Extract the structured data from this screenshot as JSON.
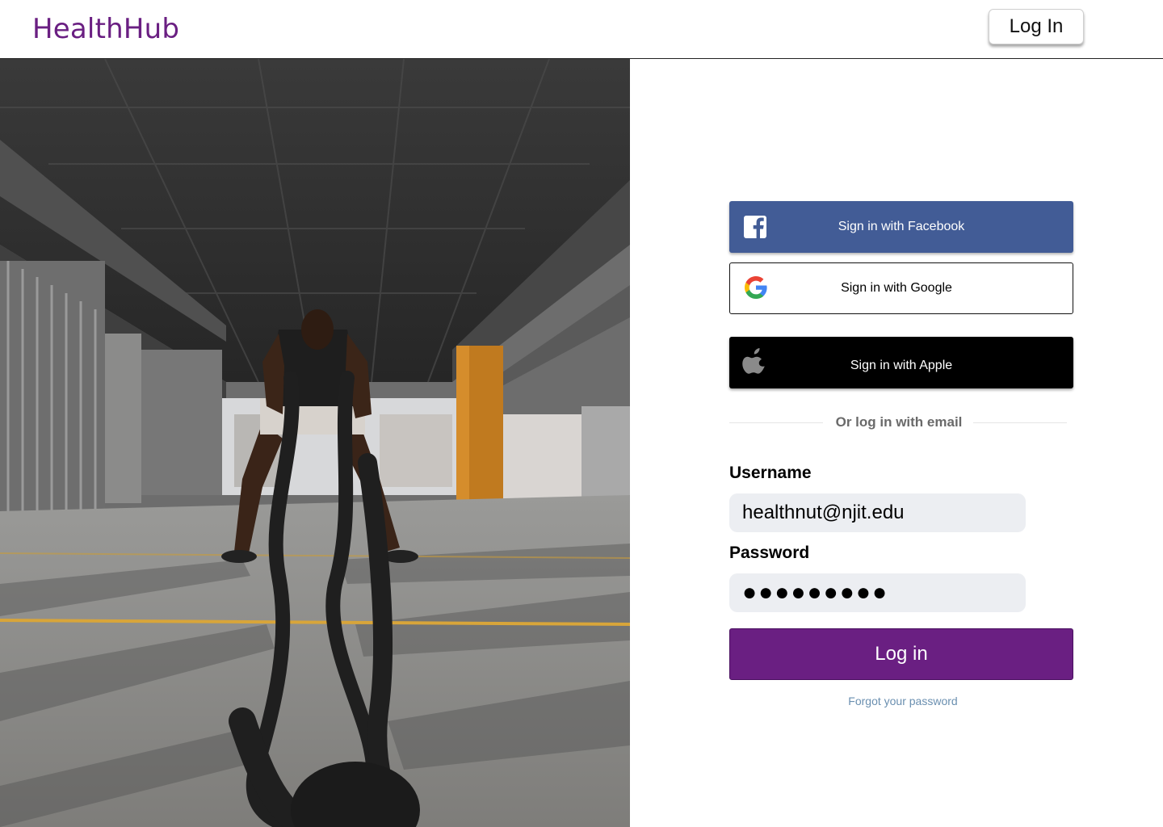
{
  "header": {
    "logo": "HealthHub",
    "login_label": "Log In"
  },
  "hero": {
    "image_name": "battle-ropes-workout-photo"
  },
  "social": {
    "facebook_label": "Sign in with Facebook",
    "google_label": "Sign in with Google",
    "apple_label": "Sign in with Apple"
  },
  "divider": {
    "text": "Or log in with email"
  },
  "form": {
    "username_label": "Username",
    "username_value": "healthnut@njit.edu",
    "password_label": "Password",
    "password_value": "●●●●●●●●●",
    "submit_label": "Log in",
    "forgot_label": "Forgot your password"
  },
  "colors": {
    "brand": "#6a1f82",
    "facebook": "#425c96",
    "apple": "#000000",
    "input_bg": "#eceef2",
    "link": "#6a8fb0"
  },
  "icons": [
    "facebook-icon",
    "google-icon",
    "apple-icon"
  ]
}
